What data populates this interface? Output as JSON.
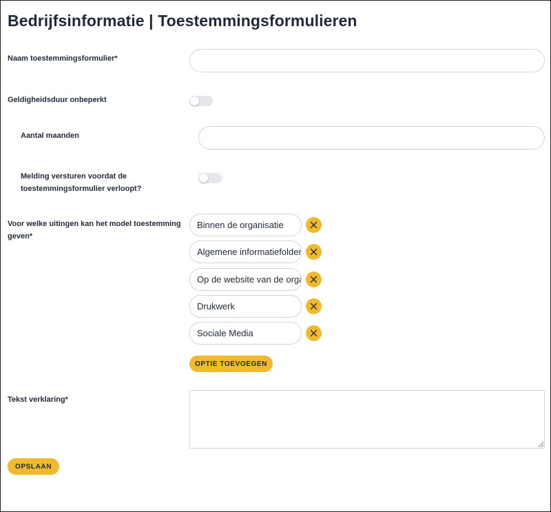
{
  "page": {
    "title": "Bedrijfsinformatie | Toestemmingsformulieren"
  },
  "form": {
    "name_label": "Naam toestemmingsformulier*",
    "name_value": "",
    "unlimited_label": "Geldigheidsduur onbeperkt",
    "unlimited_on": false,
    "months_label": "Aantal maanden",
    "months_value": "",
    "notify_label_line1": "Melding versturen voordat de",
    "notify_label_line2": "toestemmingsformulier verloopt?",
    "notify_on": false,
    "usage_label_line1": "Voor welke uitingen kan het model toestemming",
    "usage_label_line2": "geven*",
    "options": [
      {
        "value": "Binnen de organisatie"
      },
      {
        "value": "Algemene informatiefolder"
      },
      {
        "value": "Op de website van de organisatie"
      },
      {
        "value": "Drukwerk"
      },
      {
        "value": "Sociale Media"
      }
    ],
    "add_option_label": "OPTIE TOEVOEGEN",
    "declaration_label": "Tekst verklaring*",
    "declaration_value": "",
    "save_label": "OPSLAAN"
  },
  "colors": {
    "accent": "#f1ba2e",
    "toggle_off": "#e5e7eb",
    "input_border": "#d4d4d8",
    "title": "#1e293b"
  },
  "icons": {
    "remove": "close-icon",
    "resize": "resize-grip-icon"
  }
}
